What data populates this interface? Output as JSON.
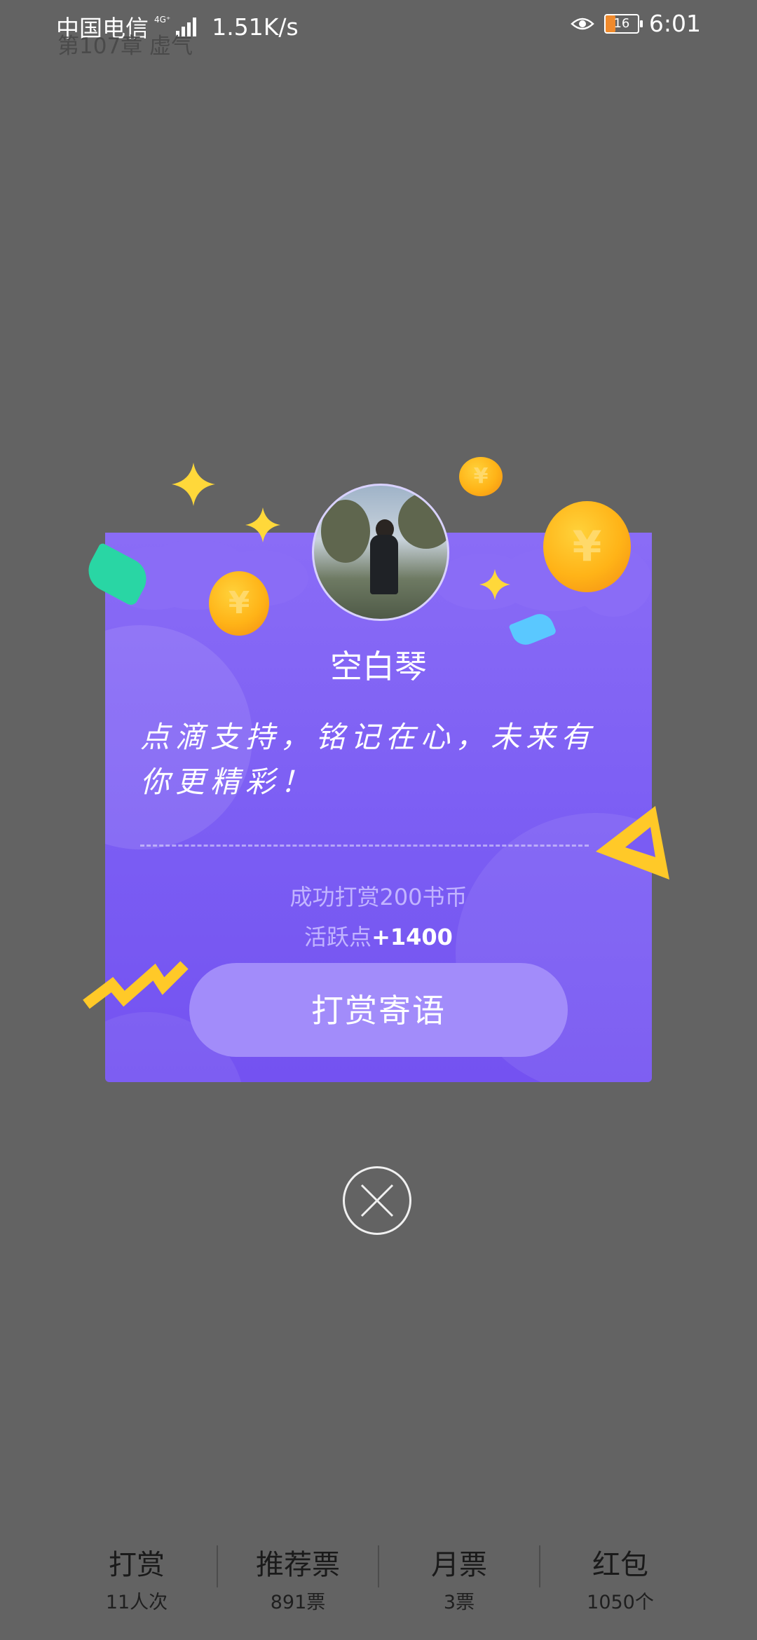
{
  "status_bar": {
    "carrier": "中国电信",
    "network": "4G⁺",
    "speed": "1.51K/s",
    "battery": "16",
    "time": "6:01"
  },
  "chapter": {
    "title": "第107章 虚气"
  },
  "reward_dialog": {
    "username": "空白琴",
    "message": "点滴支持，铭记在心，未来有你更精彩！",
    "success_text": "成功打赏200书币",
    "active_label": "活跃点",
    "active_value": "+1400",
    "button_label": "打赏寄语"
  },
  "bottom_tabs": [
    {
      "label": "打赏",
      "count": "11人次"
    },
    {
      "label": "推荐票",
      "count": "891票"
    },
    {
      "label": "月票",
      "count": "3票"
    },
    {
      "label": "红包",
      "count": "1050个"
    }
  ],
  "colors": {
    "card_top": "#8a6cf6",
    "card_bottom": "#7452f1",
    "button": "#a28cfa",
    "overlay": "#636363",
    "coin": "#ffb317"
  },
  "icons": [
    "eye-icon",
    "battery-icon",
    "signal-icon",
    "close-icon",
    "avatar",
    "coin-icon",
    "star-icon"
  ]
}
